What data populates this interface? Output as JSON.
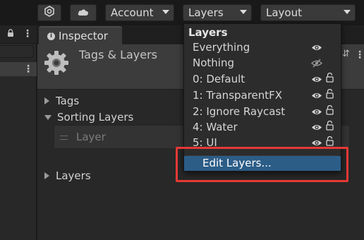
{
  "toolbar": {
    "account_label": "Account",
    "layers_label": "Layers",
    "layout_label": "Layout"
  },
  "inspector": {
    "tab_label": "Inspector",
    "title": "Tags & Layers",
    "foldouts": {
      "tags": "Tags",
      "sorting_layers": "Sorting Layers",
      "layers": "Layers"
    },
    "sorting_layer_item": "Layer"
  },
  "layers_dropdown": {
    "header": "Layers",
    "items": [
      {
        "label": "Everything",
        "visibility": "visible",
        "locked": false
      },
      {
        "label": "Nothing",
        "visibility": "hidden",
        "locked": false
      },
      {
        "label": "0: Default",
        "visibility": "visible",
        "locked": true
      },
      {
        "label": "1: TransparentFX",
        "visibility": "visible",
        "locked": true
      },
      {
        "label": "2: Ignore Raycast",
        "visibility": "visible",
        "locked": true
      },
      {
        "label": "4: Water",
        "visibility": "visible",
        "locked": true
      },
      {
        "label": "5: UI",
        "visibility": "visible",
        "locked": true
      }
    ],
    "edit_label": "Edit Layers..."
  },
  "icons": {
    "collab": "collab-icon",
    "cloud": "cloud-icon",
    "gear": "gear-icon",
    "eye": "eye-icon",
    "eye_hidden": "eye-hidden-icon",
    "lock": "lock-icon",
    "info": "info-icon"
  },
  "colors": {
    "highlight": "#e53935",
    "selected_item": "#2c5d87"
  }
}
